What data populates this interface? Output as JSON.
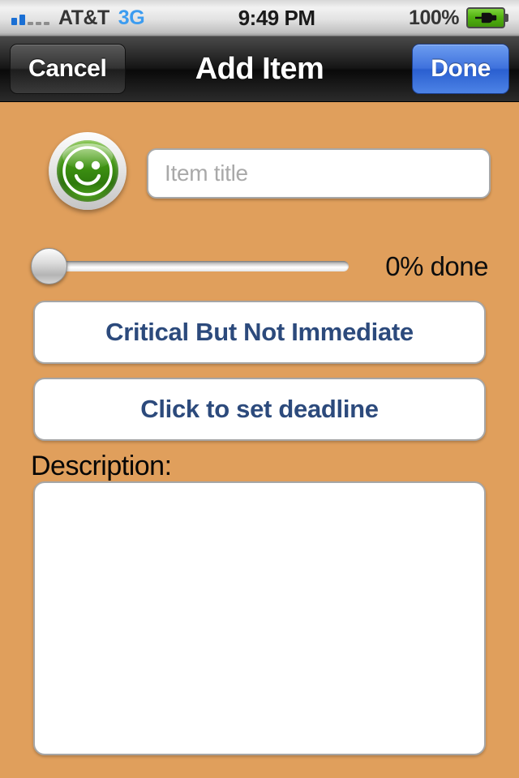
{
  "status_bar": {
    "carrier": "AT&T",
    "network": "3G",
    "time": "9:49 PM",
    "battery_percent": "100%",
    "signal_bars_filled": 2,
    "signal_bars_total": 5,
    "battery_icon": "battery-charging-icon",
    "signal_icon": "signal-bars-icon"
  },
  "nav_bar": {
    "cancel_label": "Cancel",
    "title": "Add Item",
    "done_label": "Done",
    "done_color": "#3f72dd",
    "background_color": "#161616"
  },
  "form": {
    "avatar_icon": "smiley-face-icon",
    "title_input": {
      "value": "",
      "placeholder": "Item title"
    },
    "progress": {
      "value": 0,
      "min": 0,
      "max": 100,
      "label": "0% done"
    },
    "priority_button": "Critical But Not Immediate",
    "deadline_button": "Click to set deadline",
    "description_label": "Description:",
    "description_value": "",
    "button_text_color": "#2c4a7c",
    "background_color": "#E09F5C"
  }
}
